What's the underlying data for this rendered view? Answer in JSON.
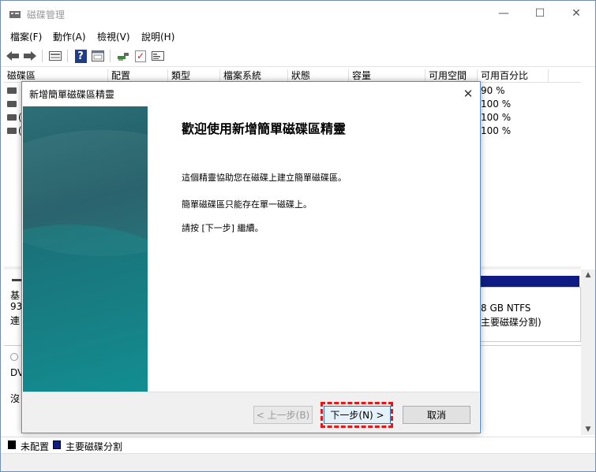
{
  "window": {
    "title": "磁碟管理",
    "min_glyph": "—",
    "max_glyph": "☐",
    "close_glyph": "✕"
  },
  "menu": [
    "檔案(F)",
    "動作(A)",
    "檢視(V)",
    "說明(H)"
  ],
  "toolbar": {
    "icons": [
      "back-arrow-icon",
      "forward-arrow-icon",
      "list-view-icon",
      "help-icon",
      "properties-icon",
      "connect-icon",
      "check-icon",
      "settings-icon"
    ],
    "help_glyph": "?",
    "check_glyph": "✓"
  },
  "volume_list": {
    "columns": [
      "磁碟區",
      "配置",
      "類型",
      "檔案系統",
      "狀態",
      "容量",
      "可用空間",
      "可用百分比"
    ],
    "rows": [
      {
        "pct": "90 %"
      },
      {
        "pct": "100 %"
      },
      {
        "pct": "100 %"
      },
      {
        "pct": "100 %"
      }
    ],
    "row_prefix": "("
  },
  "disk_map": {
    "disk0_label_line1": "基",
    "disk0_label_line2": "93",
    "disk0_label_line3": "連",
    "disk1_label_line1": "DV",
    "disk1_label_line2": "沒",
    "partition_line1": "8 GB NTFS",
    "partition_line2": "主要磁碟分割)"
  },
  "legend": {
    "unallocated": "未配置",
    "primary": "主要磁碟分割",
    "unallocated_color": "#000000",
    "primary_color": "#0e1c84"
  },
  "dialog": {
    "title": "新增簡單磁碟區精靈",
    "close_glyph": "✕",
    "heading": "歡迎使用新增簡單磁碟區精靈",
    "para1": "這個精靈協助您在磁碟上建立簡單磁碟區。",
    "para2": "簡單磁碟區只能存在單一磁碟上。",
    "para3": "請按 [下一步] 繼續。",
    "back_label": "< 上一步(B)",
    "next_label": "下一步(N) >",
    "cancel_label": "取消",
    "highlight_color": "#e01a1a"
  }
}
